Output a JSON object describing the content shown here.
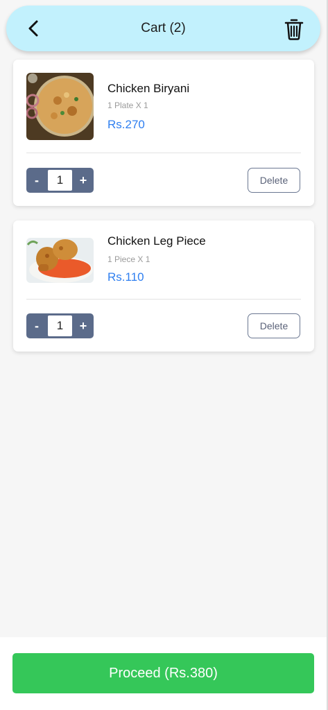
{
  "header": {
    "title": "Cart (2)",
    "back_icon": "chevron-left-icon",
    "clear_icon": "trash-icon"
  },
  "items": [
    {
      "name": "Chicken Biryani",
      "qty_text": "1 Plate X 1",
      "price": "Rs.270",
      "quantity": "1",
      "minus_label": "-",
      "plus_label": "+",
      "delete_label": "Delete",
      "image": "biryani-photo"
    },
    {
      "name": "Chicken Leg Piece",
      "qty_text": "1 Piece X 1",
      "price": "Rs.110",
      "quantity": "1",
      "minus_label": "-",
      "plus_label": "+",
      "delete_label": "Delete",
      "image": "chicken-leg-photo"
    }
  ],
  "footer": {
    "proceed_label": "Proceed (Rs.380)"
  },
  "colors": {
    "header_bg": "#c2f1fd",
    "price": "#2f7ff0",
    "stepper": "#5b6b8a",
    "proceed": "#35c759"
  }
}
